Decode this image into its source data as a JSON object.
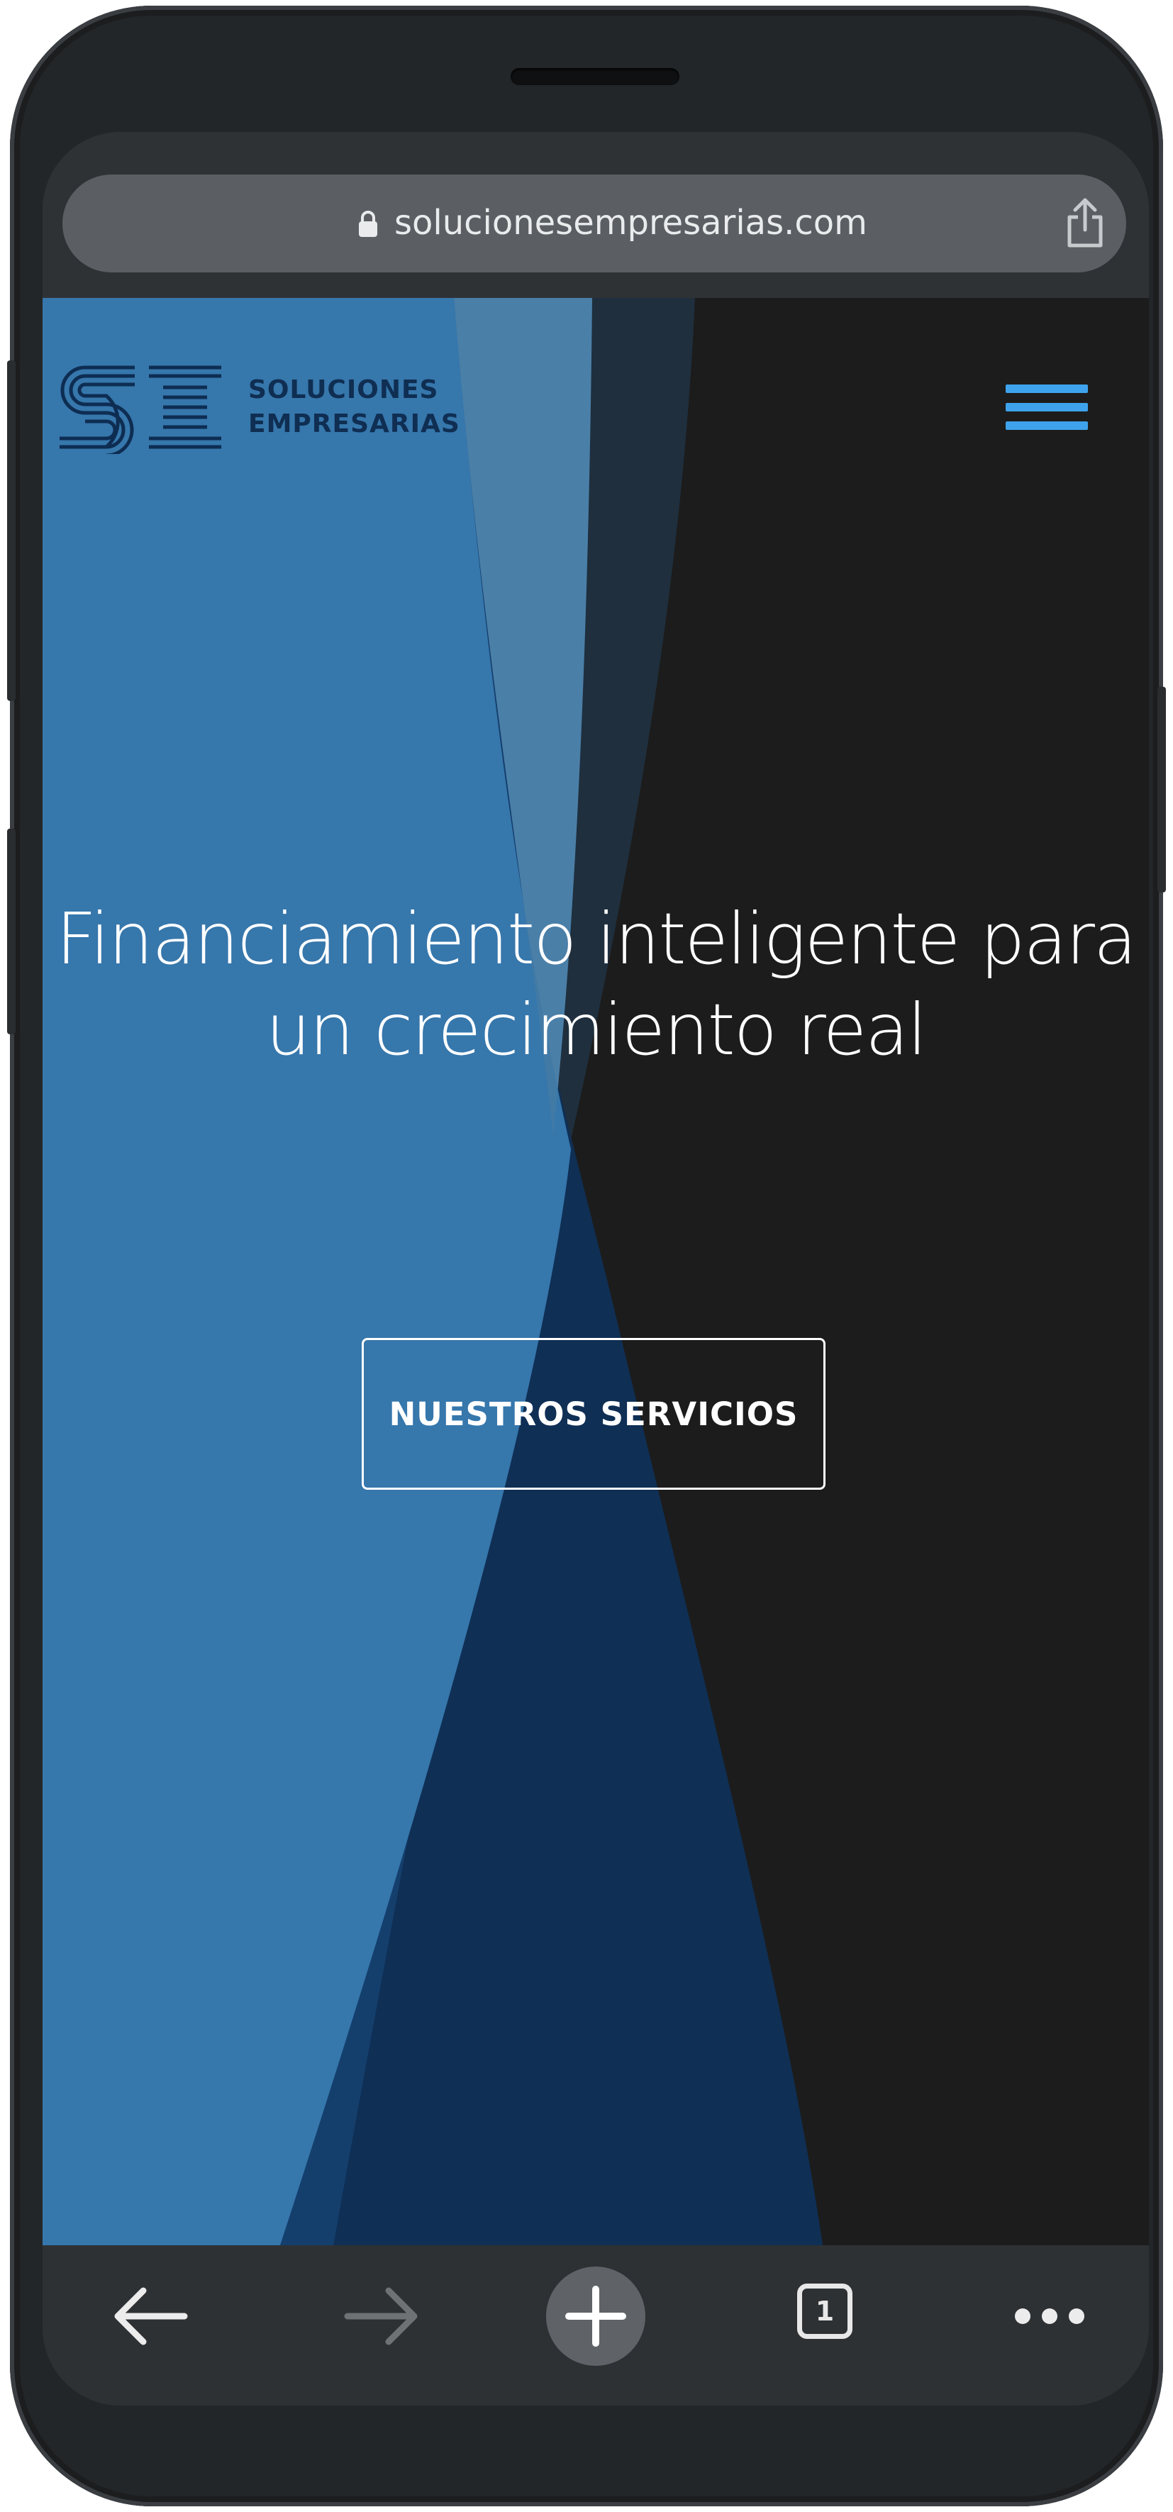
{
  "browser": {
    "url": "solucionesempresarias.com",
    "toolbar": {
      "tab_count": "1",
      "back_icon": "arrow-left-icon",
      "forward_icon": "arrow-right-icon",
      "new_tab_icon": "plus-icon",
      "menu_icon": "ellipsis-icon"
    }
  },
  "site": {
    "logo": {
      "line1": "SOLUCIONES",
      "line2": "EMPRESARIAS"
    },
    "hero": {
      "headline_line1": "Financiamiento inteligente para",
      "headline_line2": "un crecimiento real",
      "cta_label": "NUESTROS SERVICIOS"
    },
    "colors": {
      "accent": "#3ea3ec",
      "hero_blue": "#3a7bb0",
      "navy": "#0e2d52",
      "background": "#1c1c1c"
    }
  }
}
